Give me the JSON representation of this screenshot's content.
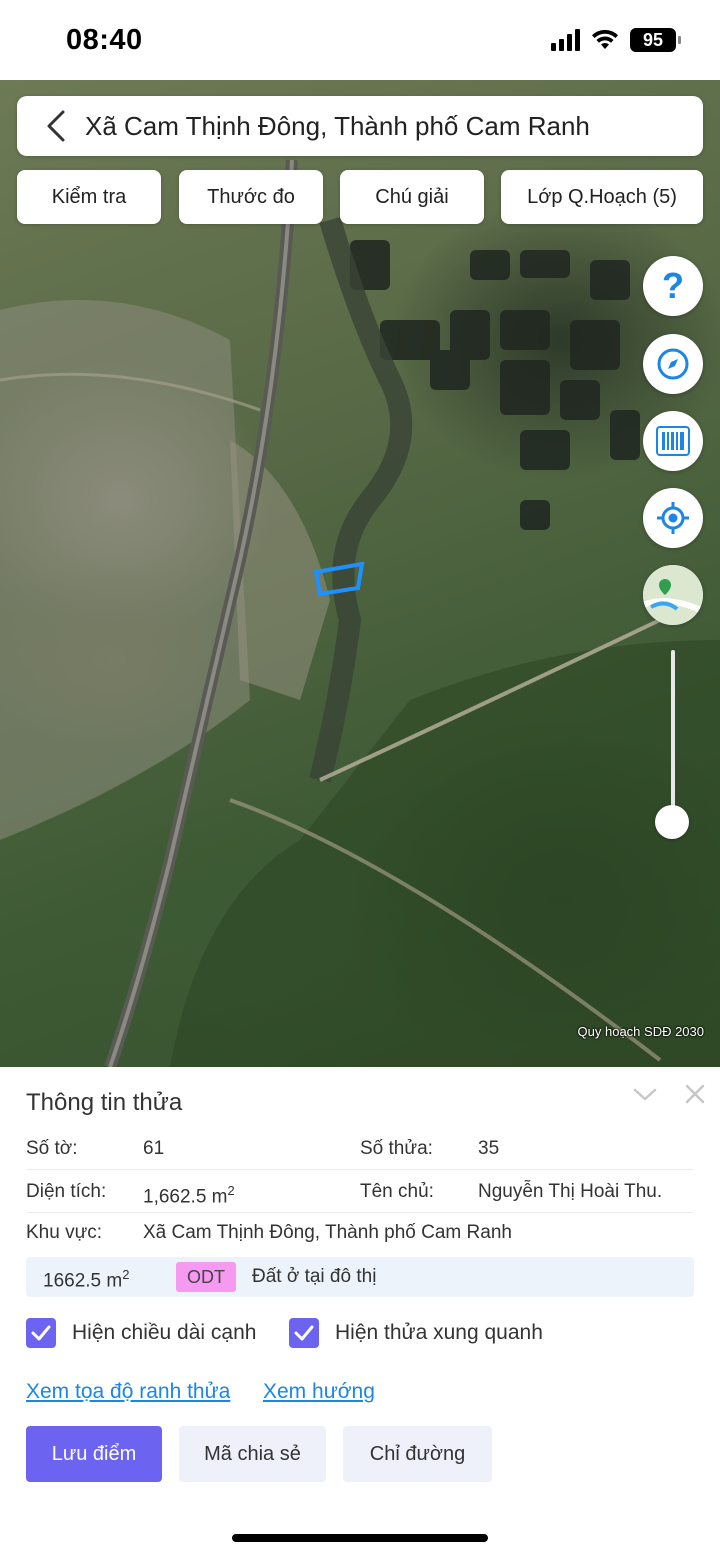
{
  "status_bar": {
    "time": "08:40",
    "battery": "95"
  },
  "search": {
    "text": "Xã Cam Thịnh Đông, Thành phố Cam Ranh"
  },
  "toolbar": {
    "check_label": "Kiểm tra",
    "measure_label": "Thước đo",
    "legend_label": "Chú giải",
    "layers_label": "Lớp Q.Hoạch (5)"
  },
  "map": {
    "watermark": "Quy hoạch SDĐ 2030",
    "help_glyph": "?",
    "zoom_level_fraction": 0.1,
    "highlight_color": "#1e90ff"
  },
  "parcel": {
    "title": "Thông tin thửa",
    "sheet_label": "Số tờ:",
    "sheet_value": "61",
    "parcel_label": "Số thửa:",
    "parcel_value": "35",
    "area_label": "Diện tích:",
    "area_value": "1,662.5 m",
    "area_unit_sup": "2",
    "owner_label": "Tên chủ:",
    "owner_value": "Nguyễn Thị Hoài Thu.",
    "region_label": "Khu vực:",
    "region_value": "Xã Cam Thịnh Đông, Thành phố Cam Ranh",
    "landuse": {
      "area": "1662.5 m",
      "area_unit_sup": "2",
      "code": "ODT",
      "description": "Đất ở tại đô thị",
      "badge_color": "#f59af0"
    }
  },
  "options": {
    "show_edge_length": "Hiện chiều dài cạnh",
    "show_edge_length_checked": true,
    "show_neighbors": "Hiện thửa xung quanh",
    "show_neighbors_checked": true
  },
  "links": {
    "view_coords": "Xem tọa độ ranh thửa",
    "view_direction": "Xem hướng"
  },
  "actions": {
    "save_point": "Lưu điểm",
    "share_code": "Mã chia sẻ",
    "directions": "Chỉ đường"
  },
  "colors": {
    "accent": "#6c63f0",
    "link": "#1b86e4",
    "icon_blue": "#1b86e4"
  }
}
